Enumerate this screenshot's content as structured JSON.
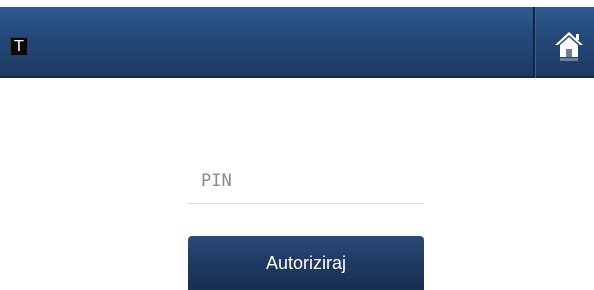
{
  "header": {
    "logo_text": "T",
    "home_icon": "home-icon",
    "background_color": "#244878"
  },
  "login": {
    "pin_placeholder": "PIN",
    "pin_value": "",
    "authorize_label": "Autoriziraj",
    "button_color": "#1f3a62"
  }
}
